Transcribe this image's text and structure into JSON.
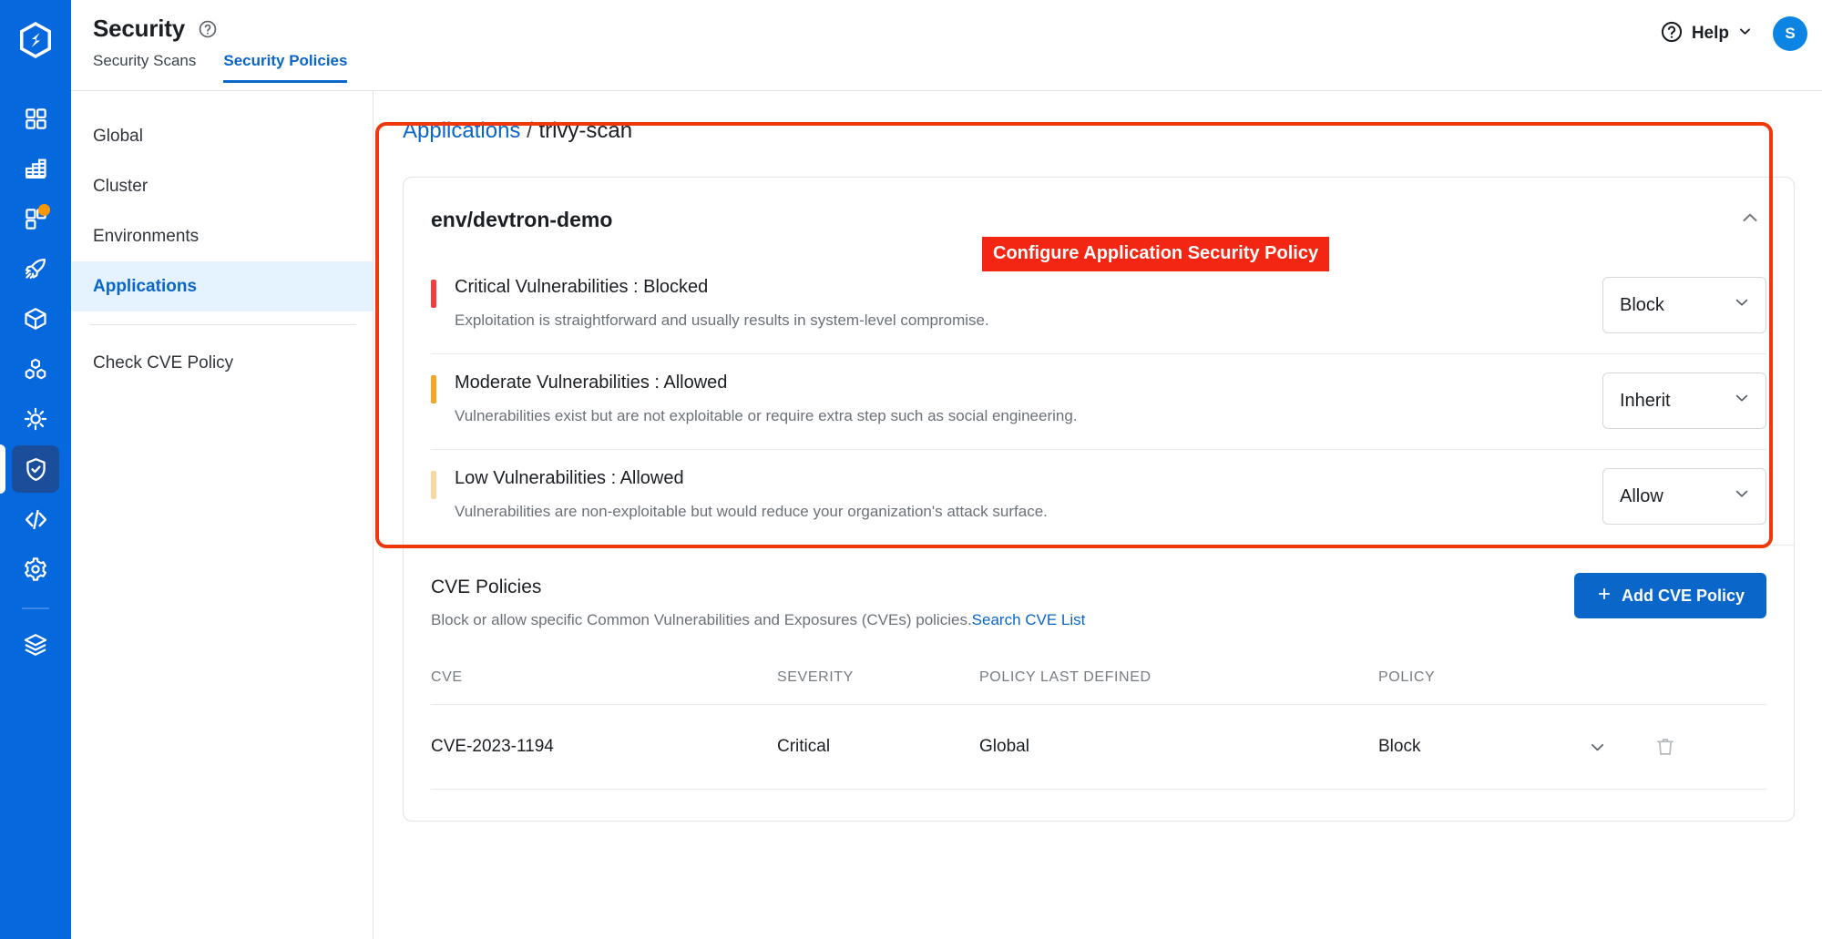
{
  "app": {
    "logo_icon": "devtron-logo-icon",
    "rail_items": [
      {
        "name": "applications-grid-icon",
        "badge": false
      },
      {
        "name": "chart-table-icon",
        "badge": false
      },
      {
        "name": "jobs-grid-icon",
        "badge": true
      },
      {
        "name": "rocket-deploy-icon",
        "badge": false
      },
      {
        "name": "cube-chart-store-icon",
        "badge": false
      },
      {
        "name": "clusters-hex-icon",
        "badge": false
      },
      {
        "name": "bulk-edit-sun-icon",
        "badge": false
      },
      {
        "name": "security-shield-icon",
        "badge": false,
        "active": true
      },
      {
        "name": "code-brackets-icon",
        "badge": false
      },
      {
        "name": "global-config-gear-icon",
        "badge": false
      },
      {
        "name": "stack-manager-layers-icon",
        "badge": false
      }
    ]
  },
  "header": {
    "title": "Security",
    "help_tooltip_icon": "question-circle-icon",
    "tabs": [
      {
        "label": "Security Scans",
        "active": false
      },
      {
        "label": "Security Policies",
        "active": true
      }
    ],
    "help_label": "Help",
    "help_icon": "question-circle-icon",
    "help_chevron_icon": "chevron-down-icon",
    "avatar_initial": "S"
  },
  "sidebar": {
    "items": [
      {
        "label": "Global",
        "active": false
      },
      {
        "label": "Cluster",
        "active": false
      },
      {
        "label": "Environments",
        "active": false
      },
      {
        "label": "Applications",
        "active": true
      }
    ],
    "secondary": [
      {
        "label": "Check CVE Policy",
        "active": false
      }
    ]
  },
  "breadcrumb": {
    "root": "Applications",
    "separator": "/",
    "current": "trivy-scan"
  },
  "annotation": {
    "label": "Configure Application Security Policy",
    "color": "#f22613",
    "border_color": "#f0380d"
  },
  "policy_card": {
    "title": "env/devtron-demo",
    "collapse_icon": "chevron-up-icon",
    "rows": [
      {
        "title": "Critical Vulnerabilities : Blocked",
        "description": "Exploitation is straightforward and usually results in system-level compromise.",
        "bar_color": "#f33e3e",
        "select_value": "Block",
        "select_icon": "chevron-down-icon"
      },
      {
        "title": "Moderate Vulnerabilities : Allowed",
        "description": "Vulnerabilities exist but are not exploitable or require extra step such as social engineering.",
        "bar_color": "#f5a623",
        "select_value": "Inherit",
        "select_icon": "chevron-down-icon"
      },
      {
        "title": "Low Vulnerabilities : Allowed",
        "description": "Vulnerabilities are non-exploitable but would reduce your organization's attack surface.",
        "bar_color": "#fbd7a2",
        "select_value": "Allow",
        "select_icon": "chevron-down-icon"
      }
    ]
  },
  "cve_section": {
    "title": "CVE Policies",
    "subtitle": "Block or allow specific Common Vulnerabilities and Exposures (CVEs) policies.",
    "link_label": "Search CVE List",
    "add_button_label": "Add CVE Policy",
    "add_button_icon": "plus-icon",
    "add_button_color": "#0a66c9",
    "columns": [
      "CVE",
      "SEVERITY",
      "POLICY LAST DEFINED",
      "POLICY"
    ],
    "rows": [
      {
        "cve": "CVE-2023-1194",
        "severity": "Critical",
        "policy_last_defined": "Global",
        "policy": "Block",
        "expand_icon": "chevron-down-icon",
        "delete_icon": "trash-icon"
      }
    ]
  }
}
